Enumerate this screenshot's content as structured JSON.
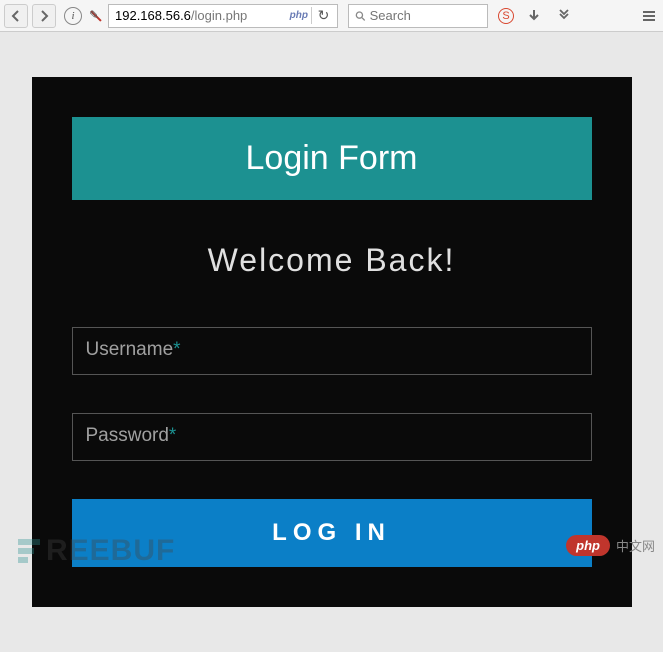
{
  "browser": {
    "url_host": "192.168.56.6",
    "url_path": "/login.php",
    "url_badge": "php",
    "search_placeholder": "Search"
  },
  "login": {
    "header": "Login Form",
    "welcome": "Welcome Back!",
    "username_label": "Username",
    "password_label": "Password",
    "required_mark": "*",
    "button_label": "LOG IN"
  },
  "watermarks": {
    "left": "REEBUF",
    "right_pill": "php",
    "right_text": "中文网"
  },
  "colors": {
    "card_bg": "#0a0a0a",
    "header_bg": "#1c9191",
    "button_bg": "#0b7fc7",
    "accent": "#1c9191"
  }
}
